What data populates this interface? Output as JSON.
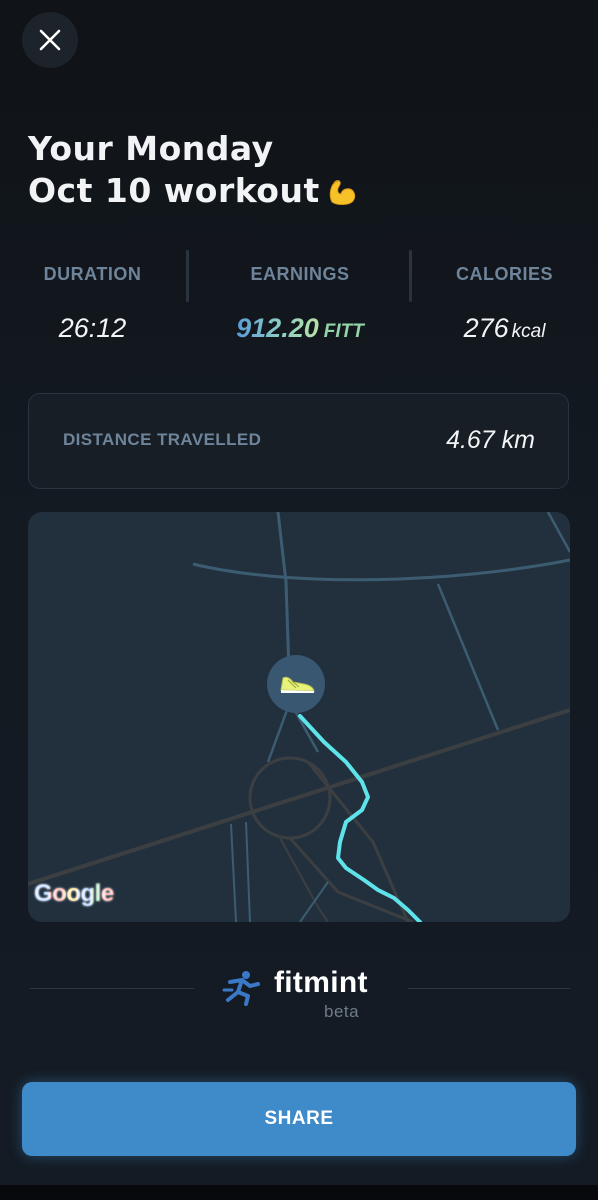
{
  "header": {
    "close_icon": "close-icon",
    "title_line1": "Your Monday",
    "title_line2": "Oct 10 workout",
    "title_emoji": "flexed-biceps-icon"
  },
  "stats": {
    "duration": {
      "label": "DURATION",
      "value": "26:12"
    },
    "earnings": {
      "label": "EARNINGS",
      "value": "912.20",
      "unit": "FITT"
    },
    "calories": {
      "label": "CALORIES",
      "value": "276",
      "unit": "kcal"
    }
  },
  "distance": {
    "label": "DISTANCE TRAVELLED",
    "value": "4.67 km"
  },
  "map": {
    "provider_logo": "Google",
    "marker_icon": "sneaker-icon"
  },
  "brand": {
    "name": "fitmint",
    "sub": "beta",
    "logo_icon": "runner-logo-icon"
  },
  "share": {
    "label": "SHARE"
  },
  "colors": {
    "accent": "#3f8ac8",
    "route": "#5fe3ea",
    "label": "#6d849a",
    "map_bg": "#22303e"
  }
}
